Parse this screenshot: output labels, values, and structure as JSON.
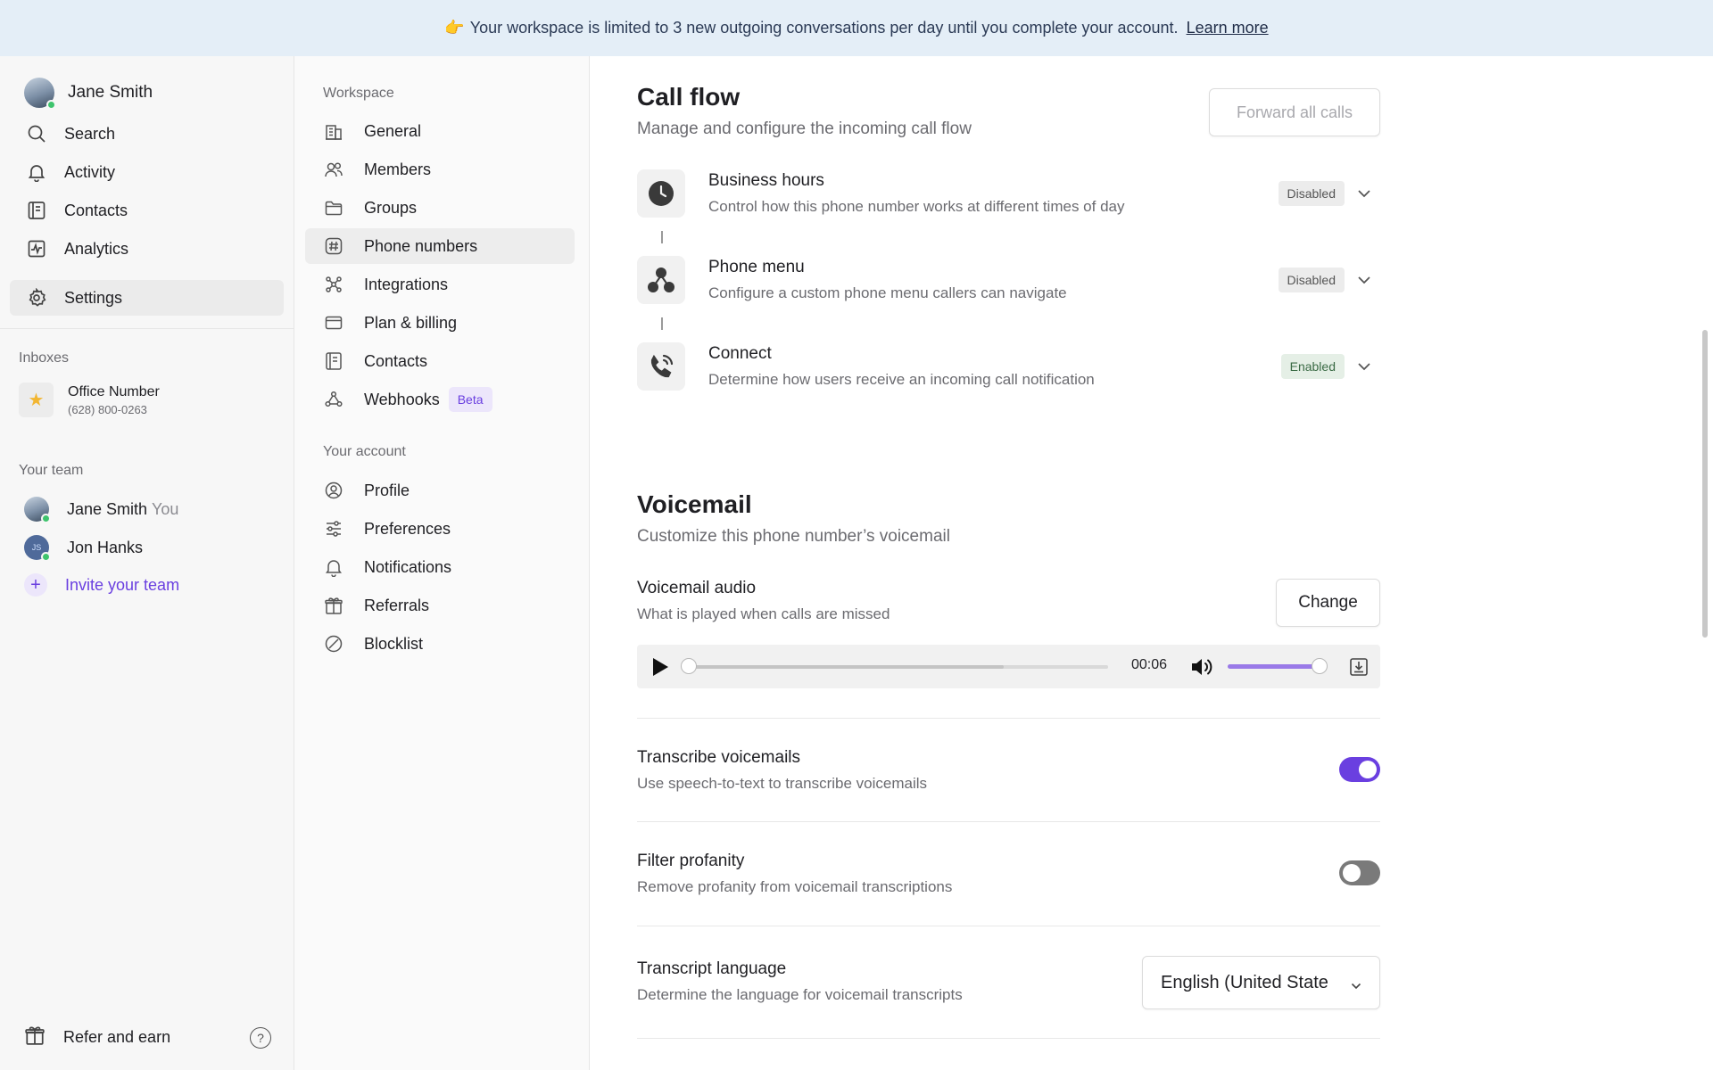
{
  "banner": {
    "emoji": "👉",
    "text": "Your workspace is limited to 3 new outgoing conversations per day until you complete your account.",
    "link": "Learn more"
  },
  "sidebar": {
    "user_name": "Jane Smith",
    "nav": [
      {
        "label": "Search",
        "icon": "search-icon"
      },
      {
        "label": "Activity",
        "icon": "bell-icon"
      },
      {
        "label": "Contacts",
        "icon": "contacts-icon"
      },
      {
        "label": "Analytics",
        "icon": "analytics-icon"
      },
      {
        "label": "Settings",
        "icon": "gear-icon",
        "active": true
      }
    ],
    "inboxes_label": "Inboxes",
    "inbox": {
      "name": "Office Number",
      "number": "(628) 800-0263",
      "icon": "star-icon"
    },
    "team_label": "Your team",
    "team": [
      {
        "name": "Jane Smith",
        "suffix": "You"
      },
      {
        "name": "Jon Hanks",
        "initials": "JS"
      }
    ],
    "invite_label": "Invite your team",
    "refer_label": "Refer and earn",
    "help_glyph": "?"
  },
  "menu": {
    "workspace_label": "Workspace",
    "workspace_items": [
      {
        "label": "General",
        "icon": "building-icon"
      },
      {
        "label": "Members",
        "icon": "members-icon"
      },
      {
        "label": "Groups",
        "icon": "folder-icon"
      },
      {
        "label": "Phone numbers",
        "icon": "hash-icon",
        "active": true
      },
      {
        "label": "Integrations",
        "icon": "integrations-icon"
      },
      {
        "label": "Plan & billing",
        "icon": "card-icon"
      },
      {
        "label": "Contacts",
        "icon": "contacts-icon"
      },
      {
        "label": "Webhooks",
        "icon": "webhook-icon",
        "badge": "Beta"
      }
    ],
    "account_label": "Your account",
    "account_items": [
      {
        "label": "Profile",
        "icon": "profile-icon"
      },
      {
        "label": "Preferences",
        "icon": "sliders-icon"
      },
      {
        "label": "Notifications",
        "icon": "bell-icon"
      },
      {
        "label": "Referrals",
        "icon": "gift-icon"
      },
      {
        "label": "Blocklist",
        "icon": "block-icon"
      }
    ]
  },
  "call_flow": {
    "title": "Call flow",
    "subtitle": "Manage and configure the incoming call flow",
    "forward_button": "Forward all calls",
    "steps": [
      {
        "title": "Business hours",
        "desc": "Control how this phone number works at different times of day",
        "status": "Disabled",
        "icon": "clock-icon"
      },
      {
        "title": "Phone menu",
        "desc": "Configure a custom phone menu callers can navigate",
        "status": "Disabled",
        "icon": "phone-menu-icon"
      },
      {
        "title": "Connect",
        "desc": "Determine how users receive an incoming call notification",
        "status": "Enabled",
        "icon": "phone-ring-icon"
      }
    ]
  },
  "voicemail": {
    "title": "Voicemail",
    "subtitle": "Customize this phone number’s voicemail",
    "audio_label": "Voicemail audio",
    "audio_desc": "What is played when calls are missed",
    "change_button": "Change",
    "player": {
      "time": "00:06",
      "progress": 0.0,
      "buffered": 0.75,
      "volume": 0.92
    },
    "transcribe_label": "Transcribe voicemails",
    "transcribe_desc": "Use speech-to-text to transcribe voicemails",
    "transcribe_on": true,
    "profanity_label": "Filter profanity",
    "profanity_desc": "Remove profanity from voicemail transcriptions",
    "profanity_on": false,
    "language_label": "Transcript language",
    "language_desc": "Determine the language for voicemail transcripts",
    "language_value": "English (United State"
  },
  "colors": {
    "accent": "#6a3fe0",
    "banner_bg": "#e4eef7",
    "enabled_badge": "#e5efe6"
  }
}
